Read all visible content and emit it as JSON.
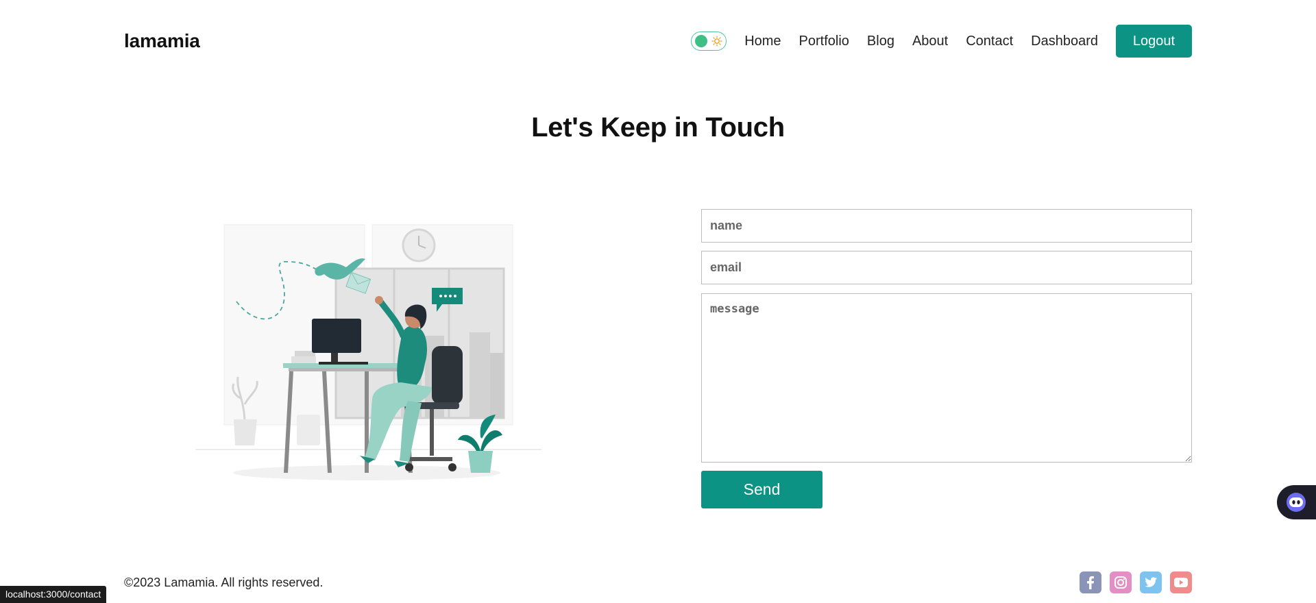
{
  "brand": {
    "logo": "lamamia"
  },
  "nav": {
    "theme_toggle": {
      "mode": "light",
      "icon": "sun-icon"
    },
    "links": [
      "Home",
      "Portfolio",
      "Blog",
      "About",
      "Contact",
      "Dashboard"
    ],
    "logout_label": "Logout"
  },
  "page": {
    "title": "Let's Keep in Touch"
  },
  "form": {
    "name_placeholder": "name",
    "email_placeholder": "email",
    "message_placeholder": "message",
    "send_label": "Send"
  },
  "footer": {
    "copyright": "©2023 Lamamia. All rights reserved.",
    "socials": [
      "facebook-icon",
      "instagram-icon",
      "twitter-icon",
      "youtube-icon"
    ]
  },
  "status_bar": {
    "url": "localhost:3000/contact"
  },
  "colors": {
    "accent": "#0d9384",
    "toggle": "#3fbf86",
    "facebook": "#8a93b8",
    "instagram": "#e38fc4",
    "twitter": "#7cc4ef",
    "youtube": "#f08b8b"
  }
}
